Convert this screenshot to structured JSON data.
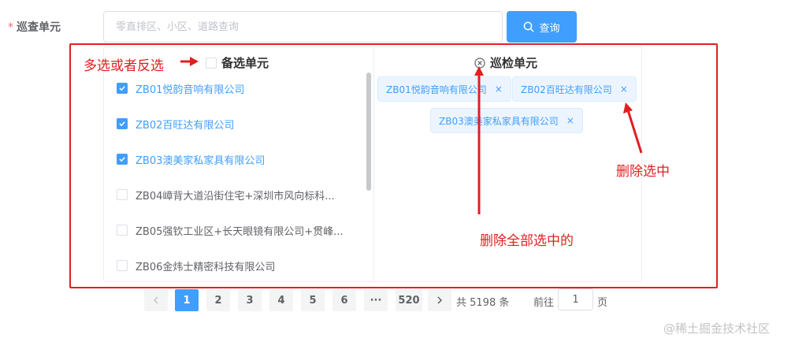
{
  "form": {
    "required_mark": "*",
    "label": "巡查单元",
    "search_placeholder": "零直排区、小区、道路查询",
    "query_button": "查询"
  },
  "transfer": {
    "left_title": "备选单元",
    "right_title": "巡检单元",
    "left_items": [
      {
        "label": "ZB01悦韵音响有限公司",
        "checked": true
      },
      {
        "label": "ZB02百旺达有限公司",
        "checked": true
      },
      {
        "label": "ZB03澳美家私家具有限公司",
        "checked": true
      },
      {
        "label": "ZB04嶂背大道沿街住宅+深圳市风向标科...",
        "checked": false
      },
      {
        "label": "ZB05强钦工业区+长天眼镜有限公司+贯峰...",
        "checked": false
      },
      {
        "label": "ZB06金炜士精密科技有限公司",
        "checked": false
      }
    ],
    "right_tags": [
      {
        "label": "ZB01悦韵音响有限公司",
        "close": "×"
      },
      {
        "label": "ZB02百旺达有限公司",
        "close": "×"
      },
      {
        "label": "ZB03澳美家私家具有限公司",
        "close": "×"
      }
    ]
  },
  "annotations": {
    "multi_select": "多选或者反选",
    "delete_selected": "删除选中",
    "delete_all": "删除全部选中的",
    "color": "#e02020"
  },
  "pagination": {
    "pages": [
      "1",
      "2",
      "3",
      "4",
      "5",
      "6"
    ],
    "ellipsis": "···",
    "last_page": "520",
    "current": "1",
    "total_text": "共 5198 条",
    "goto_label": "前往",
    "goto_value": "1",
    "page_unit": "页"
  },
  "watermark": "@稀土掘金技术社区",
  "colors": {
    "primary": "#409eff",
    "annotation": "#e02020"
  }
}
